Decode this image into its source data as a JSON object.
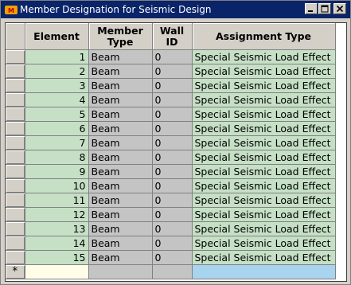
{
  "window": {
    "title": "Member Designation for Seismic Design"
  },
  "icons": {
    "app": "midas-app-icon",
    "minimize": "minimize-icon",
    "maximize": "maximize-icon",
    "close": "close-icon"
  },
  "colors": {
    "titlebar": "#0a246a",
    "editable_cell": "#c6e0c6",
    "readonly_cell": "#c4c4c4",
    "new_row_element": "#fffde8",
    "new_row_assignment": "#a8d4f0"
  },
  "grid": {
    "columns": [
      "Element",
      "Member\nType",
      "Wall\nID",
      "Assignment Type"
    ],
    "rows": [
      {
        "element": "1",
        "member_type": "Beam",
        "wall_id": "0",
        "assignment": "Special Seismic Load Effect"
      },
      {
        "element": "2",
        "member_type": "Beam",
        "wall_id": "0",
        "assignment": "Special Seismic Load Effect"
      },
      {
        "element": "3",
        "member_type": "Beam",
        "wall_id": "0",
        "assignment": "Special Seismic Load Effect"
      },
      {
        "element": "4",
        "member_type": "Beam",
        "wall_id": "0",
        "assignment": "Special Seismic Load Effect"
      },
      {
        "element": "5",
        "member_type": "Beam",
        "wall_id": "0",
        "assignment": "Special Seismic Load Effect"
      },
      {
        "element": "6",
        "member_type": "Beam",
        "wall_id": "0",
        "assignment": "Special Seismic Load Effect"
      },
      {
        "element": "7",
        "member_type": "Beam",
        "wall_id": "0",
        "assignment": "Special Seismic Load Effect"
      },
      {
        "element": "8",
        "member_type": "Beam",
        "wall_id": "0",
        "assignment": "Special Seismic Load Effect"
      },
      {
        "element": "9",
        "member_type": "Beam",
        "wall_id": "0",
        "assignment": "Special Seismic Load Effect"
      },
      {
        "element": "10",
        "member_type": "Beam",
        "wall_id": "0",
        "assignment": "Special Seismic Load Effect"
      },
      {
        "element": "11",
        "member_type": "Beam",
        "wall_id": "0",
        "assignment": "Special Seismic Load Effect"
      },
      {
        "element": "12",
        "member_type": "Beam",
        "wall_id": "0",
        "assignment": "Special Seismic Load Effect"
      },
      {
        "element": "13",
        "member_type": "Beam",
        "wall_id": "0",
        "assignment": "Special Seismic Load Effect"
      },
      {
        "element": "14",
        "member_type": "Beam",
        "wall_id": "0",
        "assignment": "Special Seismic Load Effect"
      },
      {
        "element": "15",
        "member_type": "Beam",
        "wall_id": "0",
        "assignment": "Special Seismic Load Effect"
      }
    ],
    "new_row_marker": "*"
  }
}
